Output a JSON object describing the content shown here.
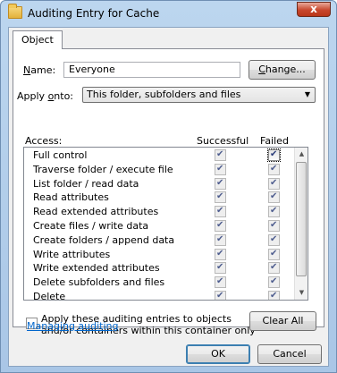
{
  "window": {
    "title": "Auditing Entry for Cache",
    "close_glyph": "x"
  },
  "tabs": [
    {
      "label": "Object"
    }
  ],
  "name_field": {
    "label_pre": "N",
    "label_post": "ame:",
    "value": "Everyone",
    "change_label_pre": "C",
    "change_label_post": "hange..."
  },
  "apply_onto": {
    "label_pre": "Apply ",
    "label_key": "o",
    "label_post": "nto:",
    "selected": "This folder, subfolders and files"
  },
  "access_list": {
    "header_access": "Access:",
    "header_successful": "Successful",
    "header_failed": "Failed",
    "rows": [
      {
        "label": "Full control",
        "successful": true,
        "failed": true
      },
      {
        "label": "Traverse folder / execute file",
        "successful": true,
        "failed": true
      },
      {
        "label": "List folder / read data",
        "successful": true,
        "failed": true
      },
      {
        "label": "Read attributes",
        "successful": true,
        "failed": true
      },
      {
        "label": "Read extended attributes",
        "successful": true,
        "failed": true
      },
      {
        "label": "Create files / write data",
        "successful": true,
        "failed": true
      },
      {
        "label": "Create folders / append data",
        "successful": true,
        "failed": true
      },
      {
        "label": "Write attributes",
        "successful": true,
        "failed": true
      },
      {
        "label": "Write extended attributes",
        "successful": true,
        "failed": true
      },
      {
        "label": "Delete subfolders and files",
        "successful": true,
        "failed": true
      },
      {
        "label": "Delete",
        "successful": true,
        "failed": true
      }
    ]
  },
  "apply_containers": {
    "checked": false,
    "line1": "Apply these auditing entries to objects",
    "line2": "and/or containers within this container only"
  },
  "clear_all_label": "Clear All",
  "managing_link": "Managing auditing",
  "footer": {
    "ok_label": "OK",
    "cancel_label": "Cancel"
  },
  "icons": {
    "title_icon": "folder-icon",
    "dropdown_icon": "chevron-down-icon",
    "scroll_up_icon": "scroll-up-arrow-icon",
    "scroll_down_icon": "scroll-down-arrow-icon"
  }
}
